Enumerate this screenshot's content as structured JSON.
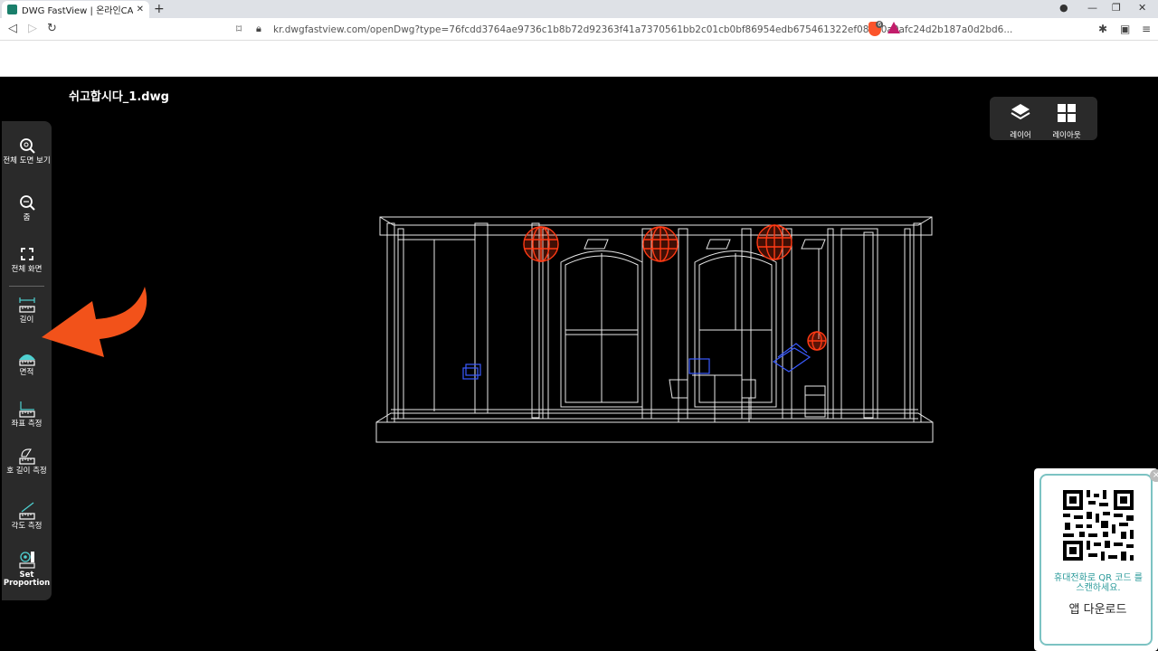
{
  "browser": {
    "tab_title": "DWG FastView | 온라인CAD 뷰어",
    "url": "kr.dwgfastview.com/openDwg?type=76fcdd3764ae9736c1b8b72d92363f41a7370561bb2c01cb0bf86954edb675461322ef08780a0afc24d2b187a0d2bd6...",
    "brave_badge": "6"
  },
  "viewer": {
    "file_title": "쉬고합시다_1.dwg",
    "toolbar": [
      {
        "label": "전체 도면 보기",
        "icon": "zoom-extents-icon"
      },
      {
        "label": "줌",
        "icon": "zoom-icon"
      },
      {
        "label": "전체 화면",
        "icon": "fullscreen-icon"
      },
      {
        "label": "길이",
        "icon": "measure-length-icon"
      },
      {
        "label": "면적",
        "icon": "measure-area-icon"
      },
      {
        "label": "좌표 측정",
        "icon": "measure-coordinate-icon"
      },
      {
        "label": "호 길이 측정",
        "icon": "measure-arc-icon"
      },
      {
        "label": "각도 측정",
        "icon": "measure-angle-icon"
      },
      {
        "label": "Set Proportion",
        "icon": "set-proportion-icon"
      }
    ],
    "right_panel": {
      "layer_label": "레이어",
      "layout_label": "레이아웃"
    },
    "qr_card": {
      "text": "휴대전화로 QR 코드 를 스캔하세요.",
      "download_label": "앱 다운로드",
      "close": "×"
    }
  },
  "colors": {
    "viewer_bg": "#000000",
    "toolbar_bg": "#2a2a2a",
    "annotation_arrow": "#f2521a",
    "cad_lamp": "#ff3a14",
    "cad_blue": "#3a5bff",
    "qr_accent": "#2a9a9a"
  }
}
